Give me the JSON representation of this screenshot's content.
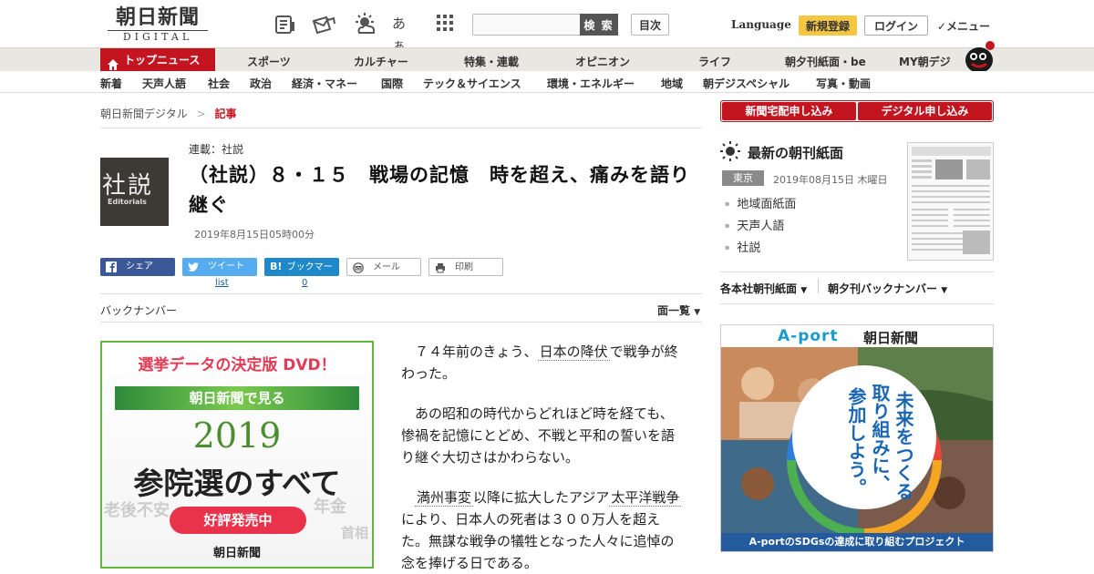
{
  "header": {
    "logo_main": "朝日新聞",
    "logo_sub": "DIGITAL",
    "search_placeholder": "",
    "search_label": "検 索",
    "index_label": "目次",
    "language_label": "Language",
    "register_label": "新規登録",
    "login_label": "ログイン",
    "menu_label": "✓メニュー",
    "font_size_icon_text": "あぁ"
  },
  "nav_main": {
    "top_news": "トップニュース",
    "items": [
      "スポーツ",
      "カルチャー",
      "特集・連載",
      "オピニオン",
      "ライフ",
      "朝夕刊紙面・be",
      "MY朝デジ"
    ]
  },
  "nav_sub": {
    "items": [
      "新着",
      "天声人語",
      "社会",
      "政治",
      "経済・マネー",
      "国際",
      "テック＆サイエンス",
      "環境・エネルギー",
      "地域",
      "朝デジスペシャル",
      "写真・動画"
    ]
  },
  "breadcrumb": {
    "home": "朝日新聞デジタル",
    "sep": ">",
    "current": "記事"
  },
  "article": {
    "thumb_kanji": "社説",
    "thumb_en": "Editorials",
    "series": "連載：社説",
    "title": "（社説）８・１５　戦場の記憶　時を超え、痛みを語り継ぐ",
    "date": "2019年8月15日05時00分",
    "share": {
      "facebook": "シェア",
      "twitter": "ツイート",
      "hatena": "ブックマーク",
      "mail": "メール",
      "print": "印刷",
      "list_link": "list",
      "bookmark_count": "0"
    },
    "backnumber": "バックナンバー",
    "page_list": "面一覧",
    "para1_a": "７４年前のきょう、",
    "para1_kw": "日本の降伏",
    "para1_b": "で戦争が終わった。",
    "para2": "あの昭和の時代からどれほど時を経ても、惨禍を記憶にとどめ、不戦と平和の誓いを語り継ぐ大切さはかわらない。",
    "para3_kw1": "満州事変",
    "para3_a": "以降に拡大したアジア",
    "para3_kw2": "太平洋戦争",
    "para3_b": "により、日本人の死者は３００万人を超えた。無謀な戦争の犠牲となった人々に追悼の念を捧げる日である。"
  },
  "ad_dvd": {
    "headline": "選挙データの決定版 DVD！",
    "band": "朝日新聞で見る",
    "year": "2019",
    "main": "参院選のすべて",
    "pill": "好評発売中",
    "logo": "朝日新聞",
    "bg_words": [
      "老後不安",
      "年金",
      "首相"
    ]
  },
  "sidebar": {
    "subscribe_paper": "新聞宅配申し込み",
    "subscribe_digital": "デジタル申し込み",
    "latest_paper": "最新の朝刊紙面",
    "region_tag": "東京",
    "paper_date": "2019年08月15日 木曜日",
    "paper_links": [
      "地域面紙面",
      "天声人語",
      "社説"
    ],
    "archive_left": "各本社朝刊紙面",
    "archive_right": "朝夕刊バックナンバー"
  },
  "ad_aport": {
    "name": "A-port",
    "paper": "朝日新聞",
    "line1": "未来をつくる",
    "line2": "取り組みに、",
    "line3": "参加しよう。",
    "bottom": "A-portのSDGsの達成に取り組むプロジェクト"
  },
  "colors": {
    "brand_red": "#c2151f",
    "nav_bg": "#e9e7e2",
    "register_yellow": "#f4c641",
    "facebook": "#3b5998",
    "twitter": "#55acee",
    "hatena": "#1f88c9",
    "dvd_green": "#5fb73c",
    "aport_blue": "#1a9acb"
  },
  "icons": {
    "header": [
      "news-icon",
      "mail-icon",
      "weather-icon",
      "font-size-icon",
      "grid-icon"
    ],
    "home": "home-icon",
    "mascot": "mascot-icon",
    "sun": "sun-icon"
  }
}
